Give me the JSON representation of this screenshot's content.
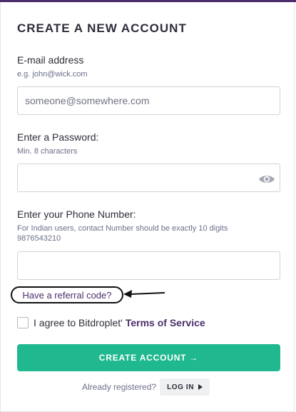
{
  "page": {
    "title": "CREATE A NEW ACCOUNT"
  },
  "email": {
    "label": "E-mail address",
    "hint": "e.g. john@wick.com",
    "placeholder": "someone@somewhere.com",
    "value": ""
  },
  "password": {
    "label": "Enter a Password:",
    "hint": "Min. 8 characters",
    "value": "",
    "icon": "eye-icon"
  },
  "phone": {
    "label": "Enter your Phone Number:",
    "hint_line1": "For Indian users, contact Number should be exactly 10 digits",
    "hint_line2": "9876543210",
    "value": ""
  },
  "referral": {
    "label": "Have a referral code?"
  },
  "terms": {
    "text": "I agree to Bitdroplet'",
    "link": "Terms of Service",
    "checked": false
  },
  "create_button": {
    "label": "CREATE ACCOUNT →"
  },
  "login": {
    "prompt": "Already registered?",
    "button_label": "LOG IN",
    "icon": "play-icon"
  },
  "colors": {
    "accent": "#20b88e",
    "brand": "#4b2e6b",
    "text": "#2e2e3a",
    "hint": "#6b6f8a"
  }
}
